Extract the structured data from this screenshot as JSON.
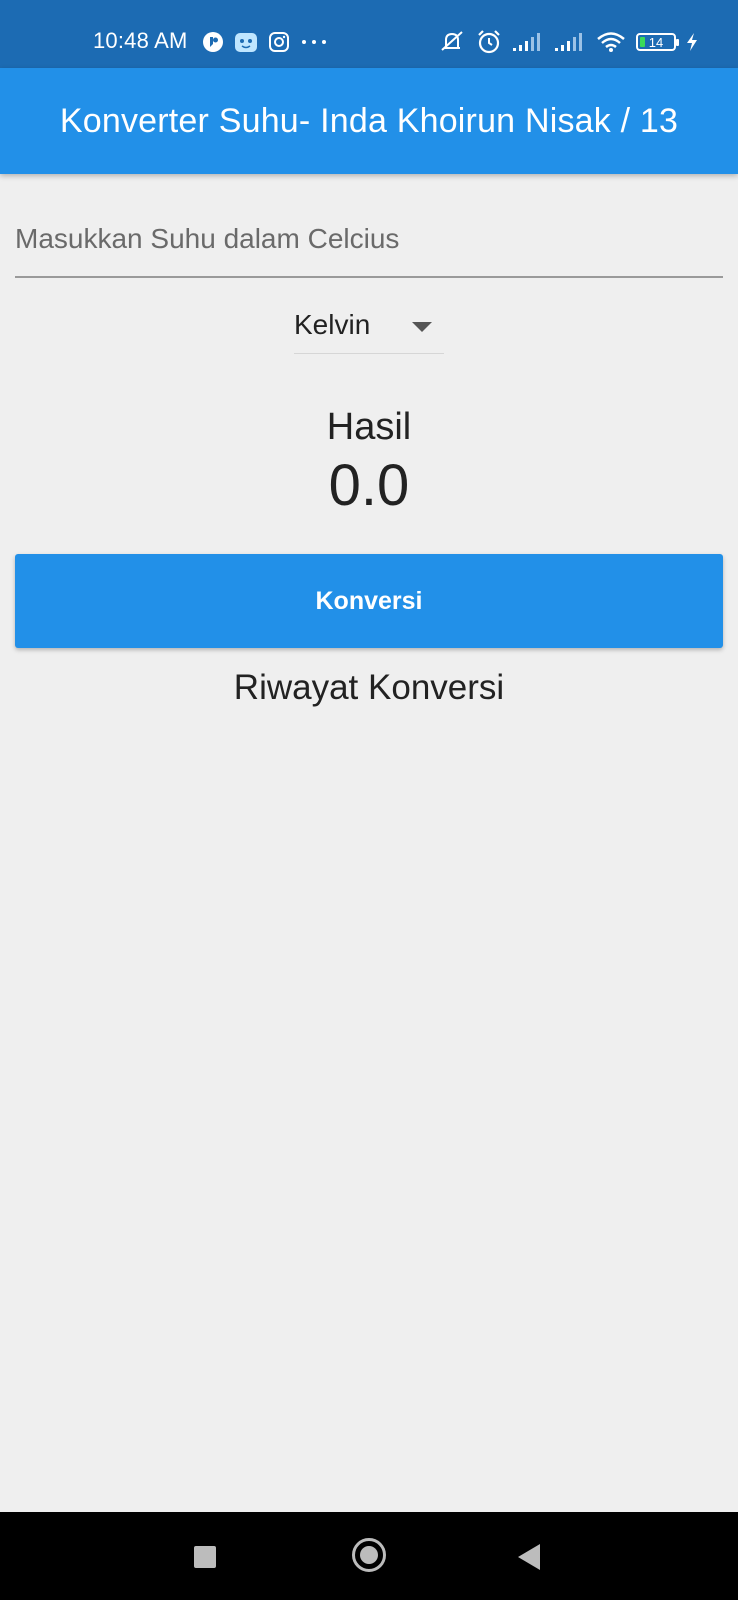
{
  "status_bar": {
    "time": "10:48 AM",
    "left_icons": [
      "messenger-icon",
      "cartoon-app-icon",
      "instagram-icon",
      "more-dots-icon"
    ],
    "right_icons": [
      "mute-icon",
      "alarm-icon",
      "signal-icon",
      "signal-icon",
      "wifi-icon",
      "battery-icon",
      "charging-icon"
    ],
    "battery_level": "14",
    "battery_fill_color": "#3adb5a"
  },
  "app_bar": {
    "title": "Konverter Suhu- Inda Khoirun Nisak / 13",
    "color": "#2290e8"
  },
  "input": {
    "placeholder": "Masukkan Suhu dalam Celcius",
    "value": ""
  },
  "dropdown": {
    "selected": "Kelvin",
    "icon": "dropdown-arrow-icon"
  },
  "result": {
    "label": "Hasil",
    "value": "0.0"
  },
  "convert_button": {
    "label": "Konversi",
    "color": "#2290e8"
  },
  "history": {
    "title": "Riwayat Konversi",
    "items": []
  },
  "nav_bar": {
    "icons": [
      "recents-square-icon",
      "home-circle-icon",
      "back-triangle-icon"
    ]
  }
}
